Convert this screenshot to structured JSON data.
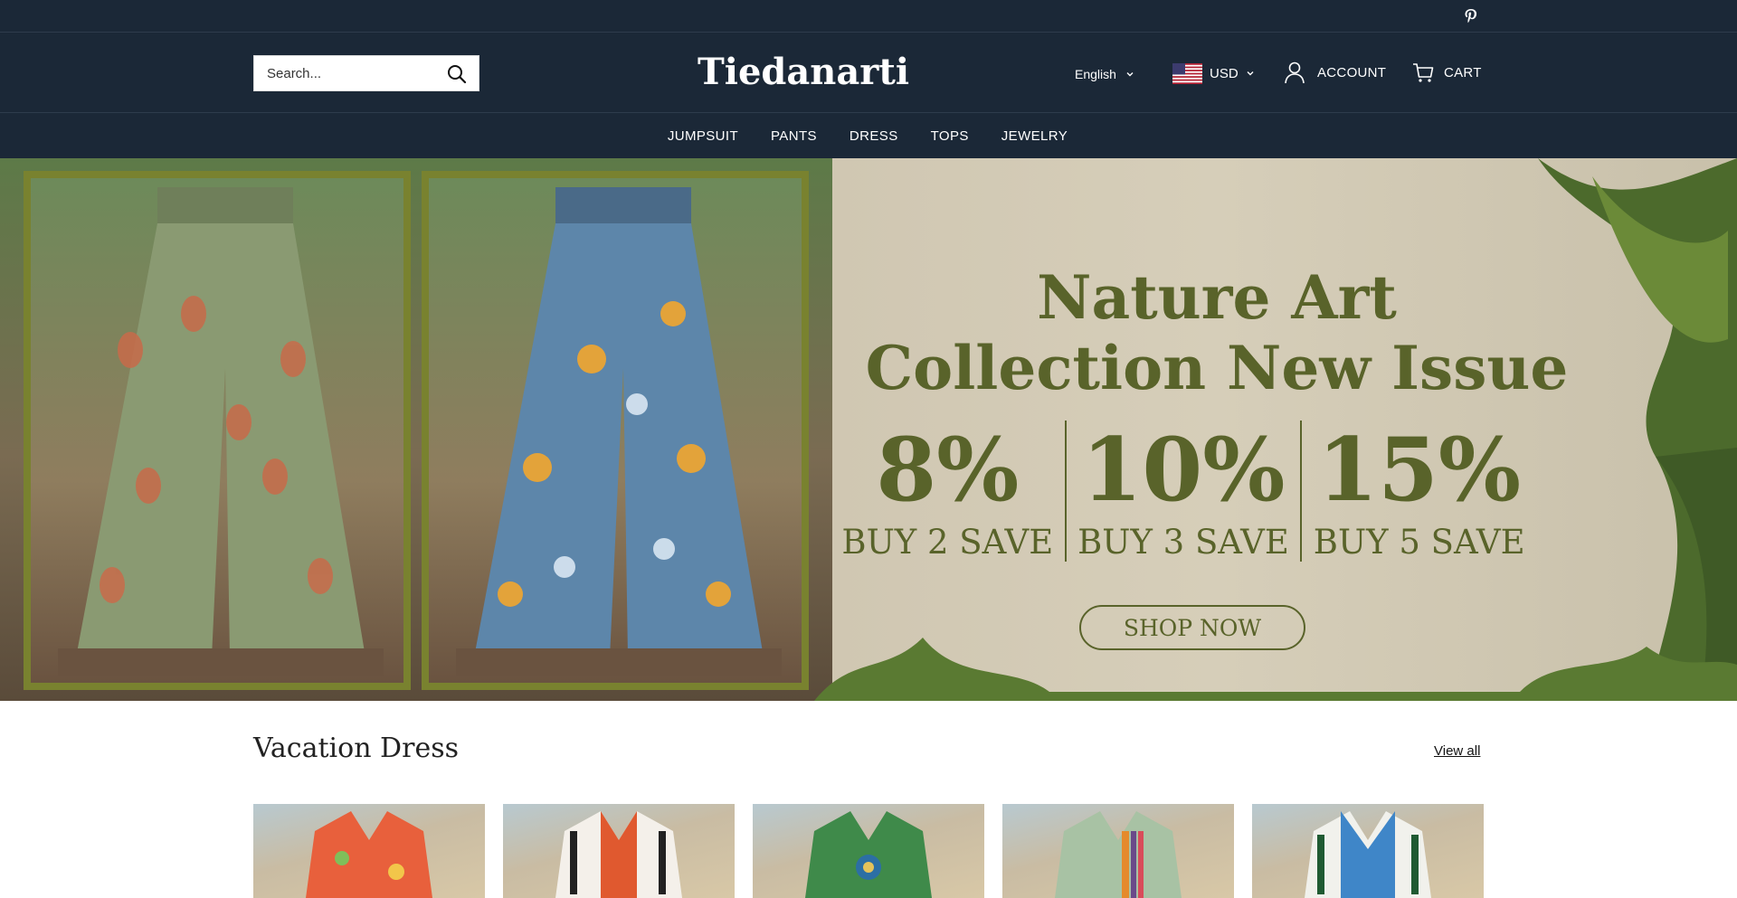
{
  "topbar": {
    "social_icon": "pinterest-icon"
  },
  "header": {
    "search_placeholder": "Search...",
    "logo_text": "Tiedanarti",
    "language": "English",
    "currency": "USD",
    "account_label": "ACCOUNT",
    "cart_label": "CART"
  },
  "nav": {
    "items": [
      "JUMPSUIT",
      "PANTS",
      "DRESS",
      "TOPS",
      "JEWELRY"
    ]
  },
  "banner": {
    "headline_line1": "Nature Art",
    "headline_line2": "Collection New Issue",
    "offers": [
      {
        "pct": "8%",
        "save": "BUY 2 SAVE"
      },
      {
        "pct": "10%",
        "save": "BUY 3 SAVE"
      },
      {
        "pct": "15%",
        "save": "BUY 5 SAVE"
      }
    ],
    "cta": "SHOP NOW",
    "accent_color": "#59632a"
  },
  "section": {
    "title": "Vacation Dress",
    "view_all": "View all"
  },
  "colors": {
    "header_bg": "#1b2837",
    "frame": "#79822f"
  }
}
